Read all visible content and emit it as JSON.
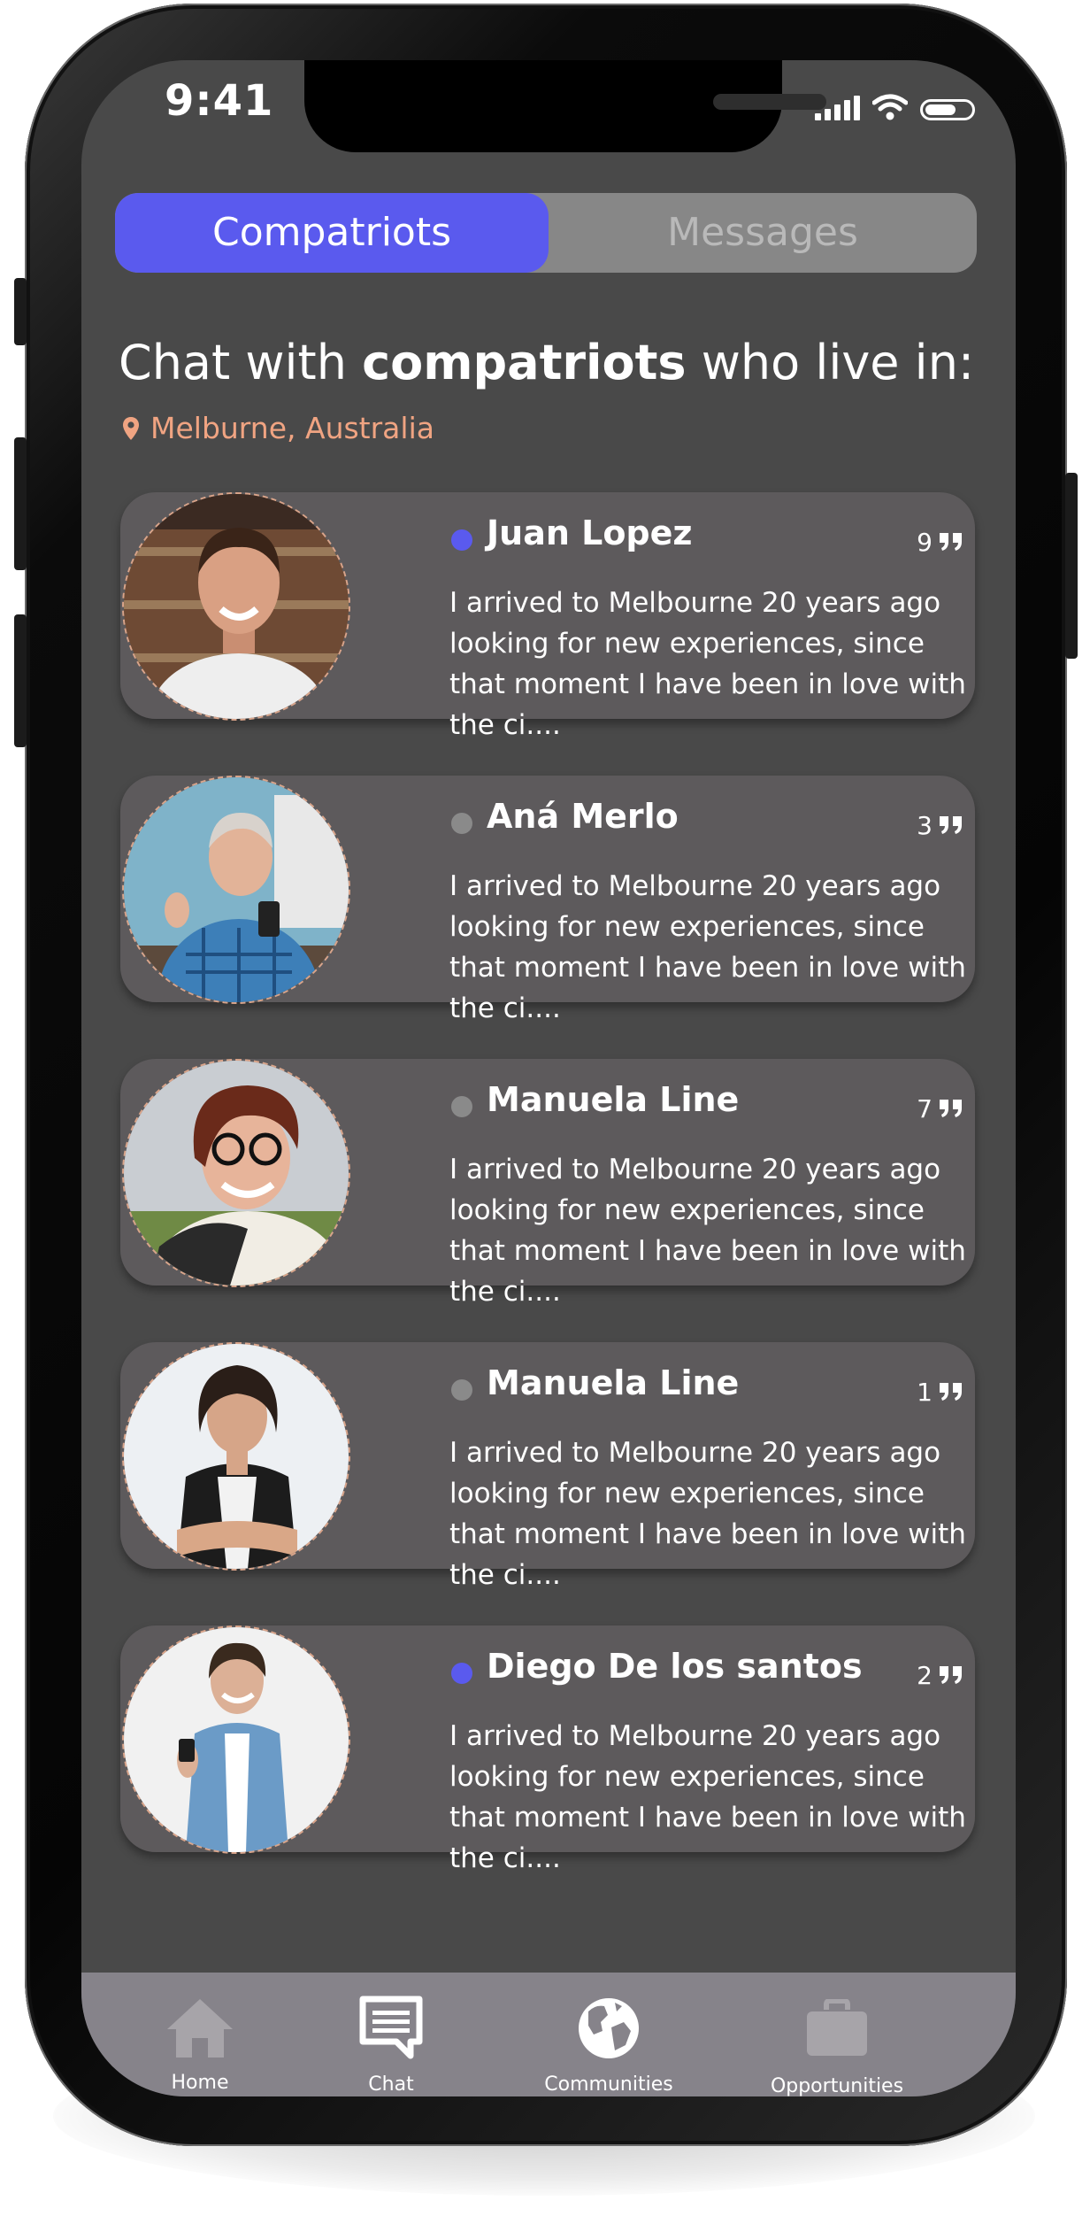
{
  "status_bar": {
    "time": "9:41"
  },
  "tabs": [
    {
      "label": "Compatriots",
      "active": true
    },
    {
      "label": "Messages",
      "active": false
    }
  ],
  "heading": {
    "prefix": "Chat with ",
    "bold": "compatriots",
    "suffix": " who live in:"
  },
  "location": {
    "icon": "pin-icon",
    "text": "Melburne, Australia"
  },
  "contacts": [
    {
      "name": "Juan Lopez",
      "online": true,
      "count": "9",
      "message": "I arrived to Melbourne 20 years ago looking for new experiences, since that moment I have been in love with the ci...."
    },
    {
      "name": "Aná Merlo",
      "online": false,
      "count": "3",
      "message": "I arrived to Melbourne 20 years ago looking for new experiences, since that moment I have been in love with the ci...."
    },
    {
      "name": "Manuela Line",
      "online": false,
      "count": "7",
      "message": "I arrived to Melbourne 20 years ago looking for new experiences, since that moment I have been in love with the ci...."
    },
    {
      "name": "Manuela Line",
      "online": false,
      "count": "1",
      "message": "I arrived to Melbourne 20 years ago looking for new experiences, since that moment I have been in love with the ci...."
    },
    {
      "name": "Diego De los santos",
      "online": true,
      "count": "2",
      "message": "I arrived to Melbourne 20 years ago looking for new experiences, since that moment I have been in love with the ci...."
    }
  ],
  "bottom_nav": [
    {
      "label": "Home",
      "icon": "home-icon"
    },
    {
      "label": "Chat",
      "icon": "chat-icon"
    },
    {
      "label": "Communities",
      "icon": "globe-icon"
    },
    {
      "label": "Opportunities",
      "icon": "briefcase-icon"
    }
  ],
  "colors": {
    "accent": "#5a5aee",
    "online": "#5a5aee",
    "offline": "#8a8a8a",
    "location": "#f0a482",
    "card": "#5d5a5c",
    "screen": "#494949"
  }
}
